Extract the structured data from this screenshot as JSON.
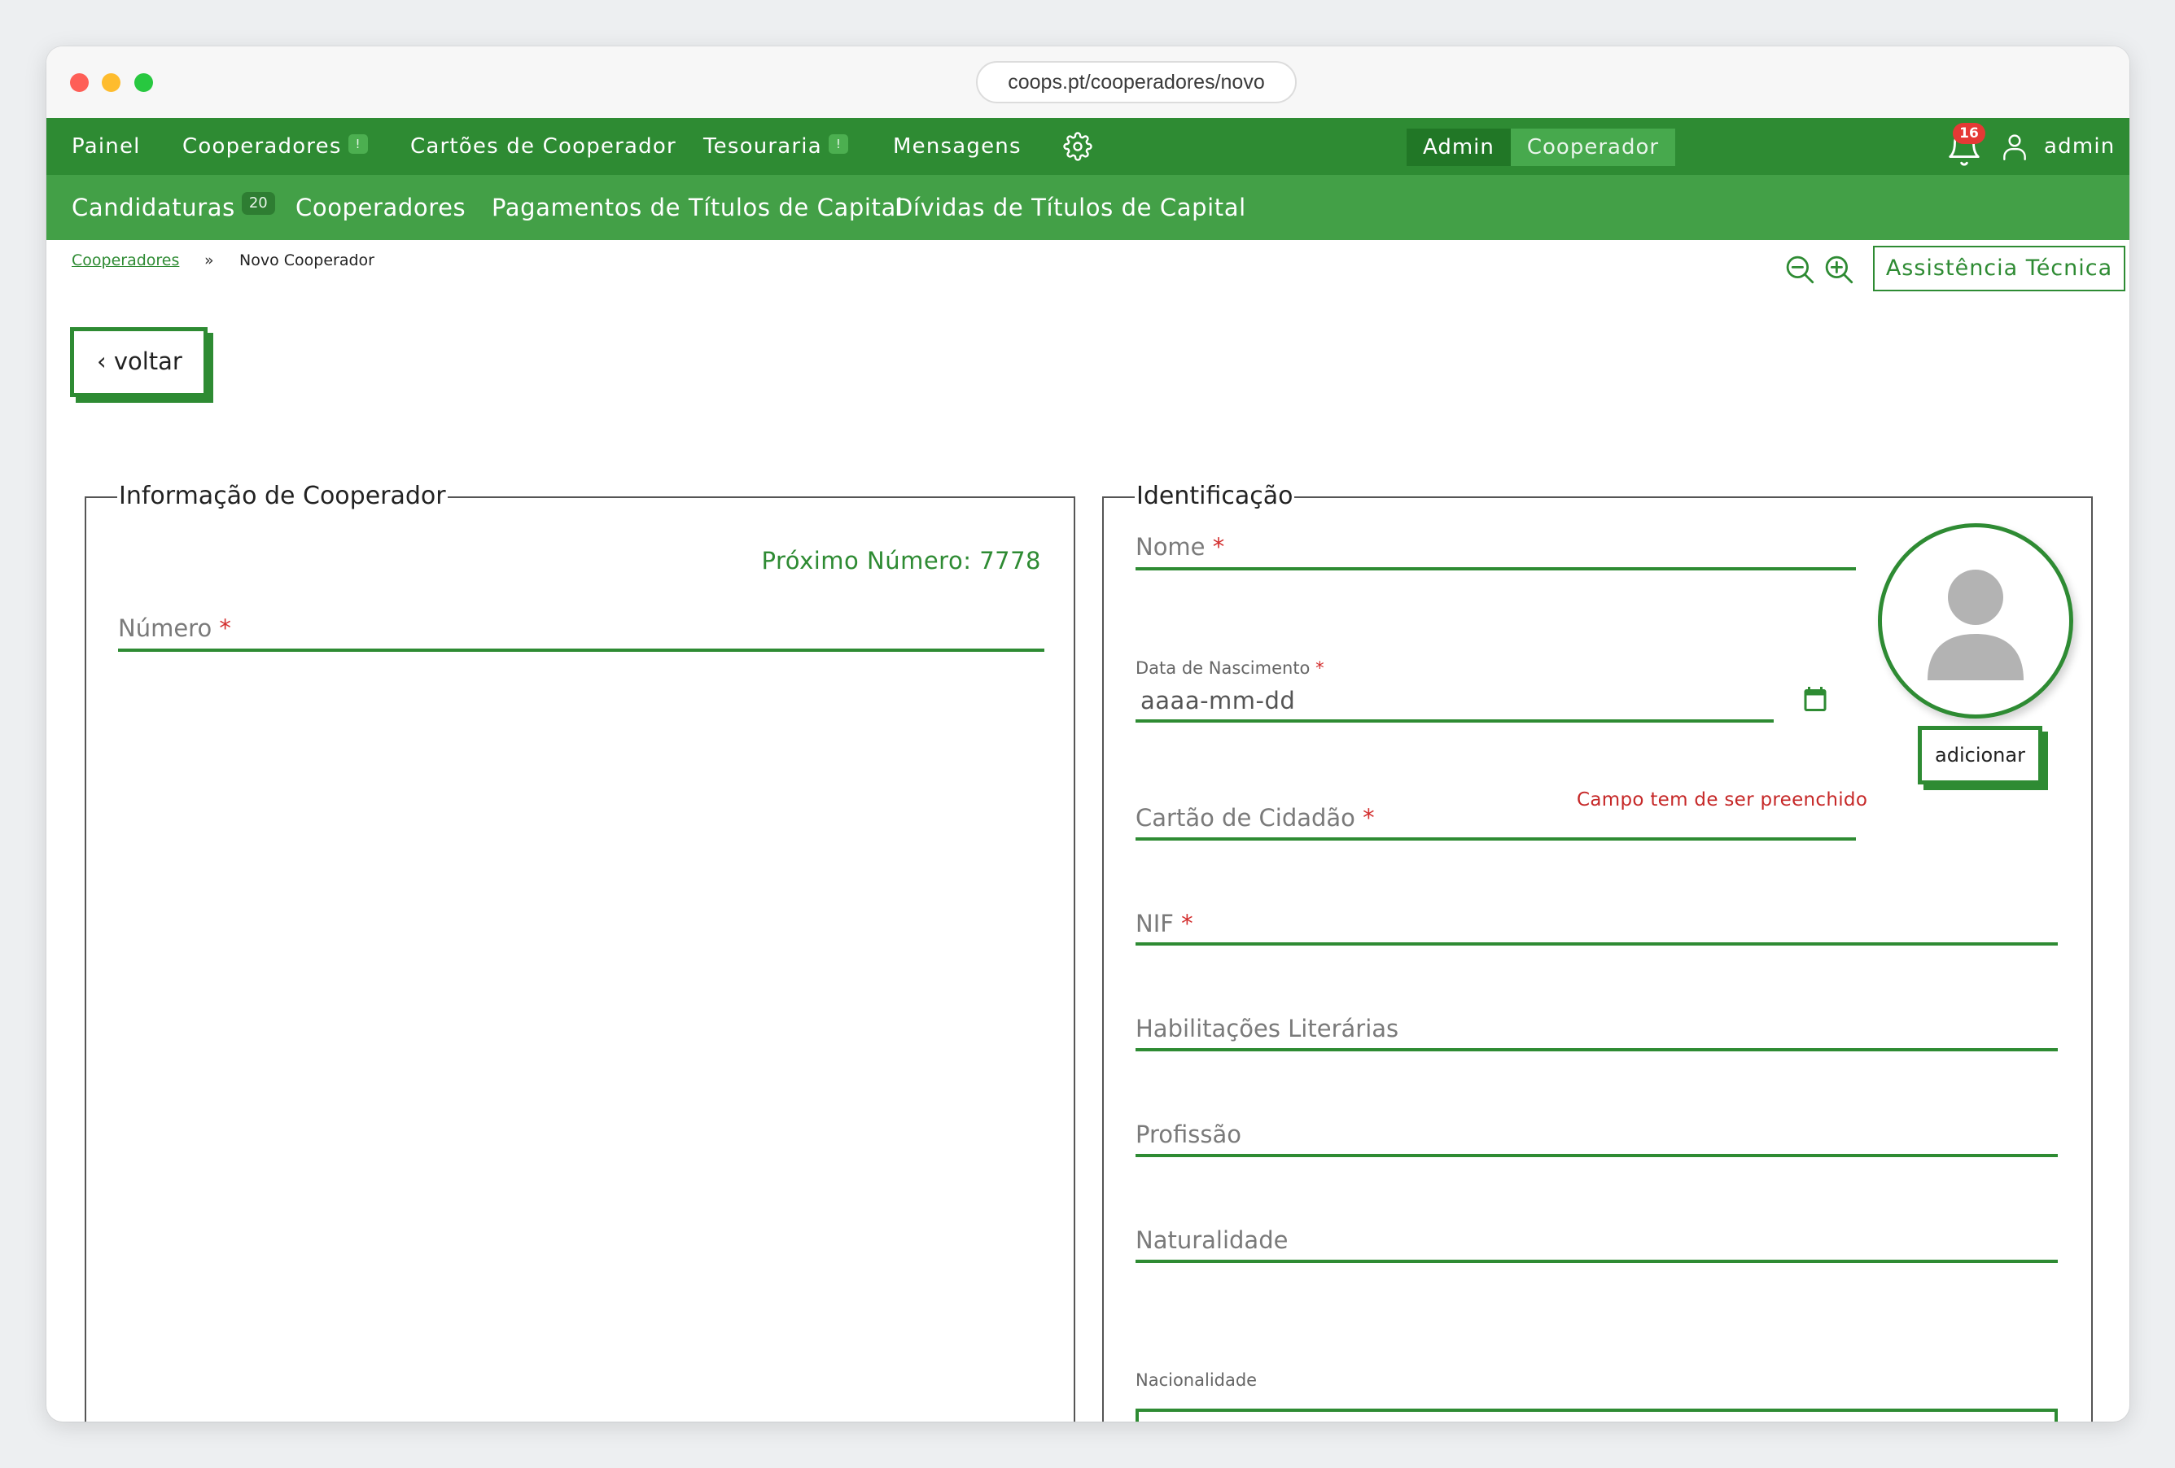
{
  "browser": {
    "url": "coops.pt/cooperadores/novo"
  },
  "top_nav": {
    "items": [
      {
        "label": "Painel",
        "badge": ""
      },
      {
        "label": "Cooperadores",
        "badge": "!"
      },
      {
        "label": "Cartões de Cooperador",
        "badge": ""
      },
      {
        "label": "Tesouraria",
        "badge": "!"
      },
      {
        "label": "Mensagens",
        "badge": ""
      }
    ],
    "settings_icon": "gear-icon",
    "mode_switch": {
      "admin": "Admin",
      "cooperador": "Cooperador",
      "active": "Admin"
    },
    "notifications": {
      "icon": "bell-icon",
      "count": "16"
    },
    "user": {
      "icon": "user-icon",
      "name": "admin"
    }
  },
  "sub_nav": {
    "items": [
      {
        "label": "Candidaturas",
        "badge": "20"
      },
      {
        "label": "Cooperadores",
        "badge": ""
      },
      {
        "label": "Pagamentos de Títulos de Capital",
        "badge": ""
      },
      {
        "label": "Dívidas de Títulos de Capital",
        "badge": ""
      }
    ]
  },
  "breadcrumb": {
    "link": "Cooperadores",
    "separator": "»",
    "current": "Novo Cooperador"
  },
  "toolbar": {
    "zoom_out_icon": "zoom-out-icon",
    "zoom_in_icon": "zoom-in-icon",
    "tech_support": "Assistência Técnica"
  },
  "back_button": "‹ voltar",
  "info_panel": {
    "title": "Informação de Cooperador",
    "next_number": "Próximo Número: 7778",
    "numero_label": "Número",
    "required_mark": "*"
  },
  "identification": {
    "title": "Identificação",
    "nome_label": "Nome",
    "birth_label": "Data de Nascimento",
    "birth_placeholder": "aaaa-mm-dd",
    "birth_error": "Campo tem de ser preenchido",
    "calendar_icon": "calendar-icon",
    "cartao_label": "Cartão de Cidadão",
    "nif_label": "NIF",
    "habilitacoes_label": "Habilitações Literárias",
    "profissao_label": "Profissão",
    "naturalidade_label": "Naturalidade",
    "nacionalidade_label": "Nacionalidade",
    "nacionalidade_value": "",
    "photo_button": "adicionar",
    "avatar_icon": "avatar-placeholder-icon",
    "required_mark": "*"
  },
  "colors": {
    "primary_green": "#2e8b33",
    "secondary_green": "#43a047",
    "error_red": "#d32f2f"
  }
}
